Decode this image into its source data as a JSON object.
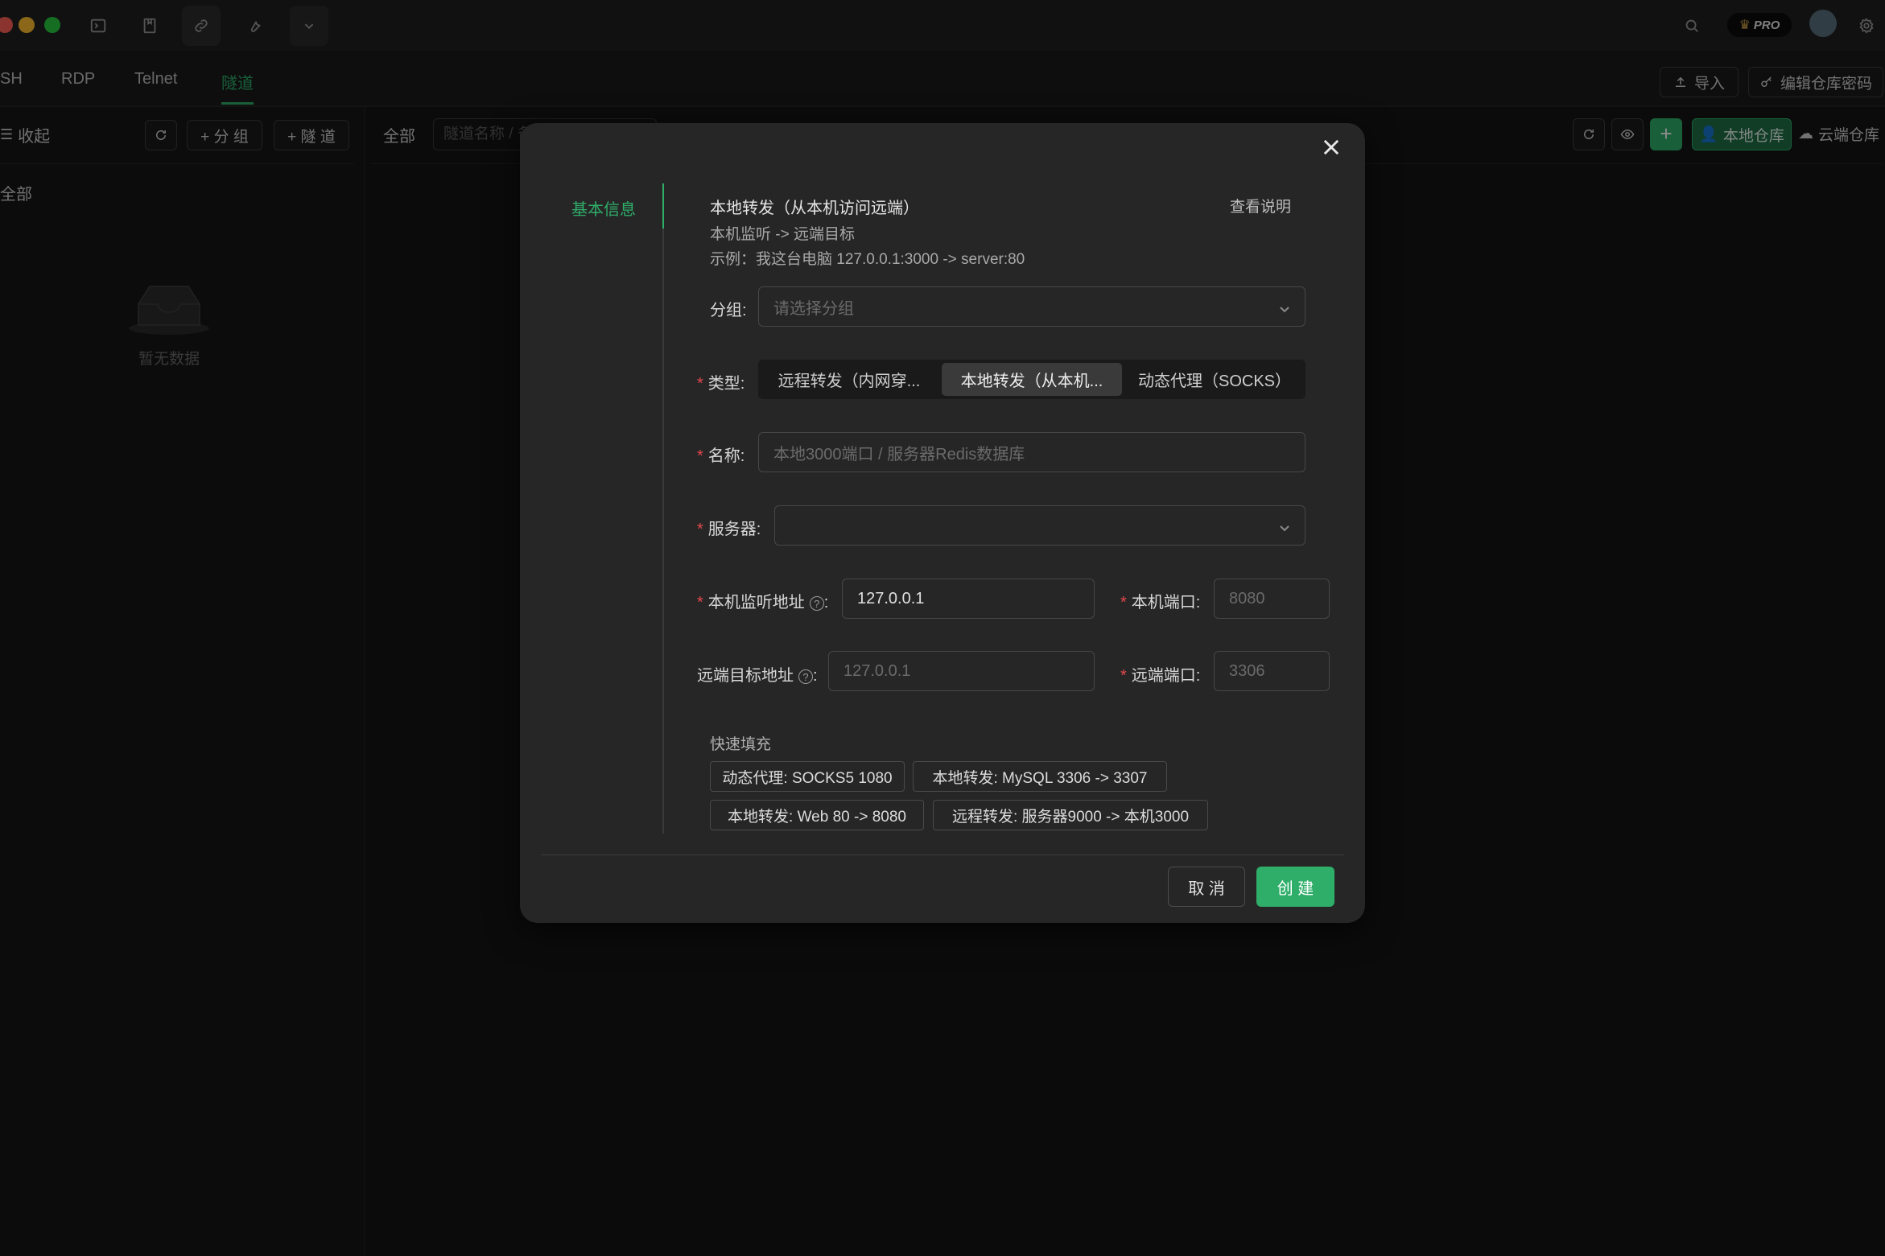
{
  "titlebar": {
    "pro_badge": "PRO"
  },
  "protocol_tabs": [
    "SH",
    "RDP",
    "Telnet",
    "隧道"
  ],
  "toolbar_right": {
    "import": "导入",
    "edit_password": "编辑仓库密码"
  },
  "sidebar": {
    "collapse": "收起",
    "add_group": "+ 分 组",
    "add_tunnel": "+ 隧 道",
    "all": "全部",
    "empty": "暂无数据"
  },
  "main": {
    "filter_all": "全部",
    "search_placeholder": "隧道名称 / 备注",
    "local_repo": "本地仓库",
    "cloud_repo": "云端仓库"
  },
  "modal": {
    "side_tab": "基本信息",
    "heading": "本地转发（从本机访问远端）",
    "desc_line1": "本机监听 -> 远端目标",
    "desc_line2": "示例：我这台电脑 127.0.0.1:3000 -> server:80",
    "help_link": "查看说明",
    "group_label": "分组:",
    "group_placeholder": "请选择分组",
    "type_label": "类型:",
    "type_options": [
      "远程转发（内网穿...",
      "本地转发（从本机...",
      "动态代理（SOCKS）"
    ],
    "type_selected": "本地转发（从本机...",
    "name_label": "名称:",
    "name_placeholder": "本地3000端口 / 服务器Redis数据库",
    "server_label": "服务器:",
    "local_addr_label": "本机监听地址",
    "local_addr_value": "127.0.0.1",
    "local_port_label": "本机端口:",
    "local_port_placeholder": "8080",
    "remote_addr_label": "远端目标地址",
    "remote_addr_placeholder": "127.0.0.1",
    "remote_port_label": "远端端口:",
    "remote_port_placeholder": "3306",
    "quick_fill_title": "快速填充",
    "quick_fill": [
      "动态代理: SOCKS5 1080",
      "本地转发: MySQL 3306 -> 3307",
      "本地转发: Web 80 -> 8080",
      "远程转发: 服务器9000 -> 本机3000"
    ],
    "cancel": "取 消",
    "create": "创 建"
  },
  "colors": {
    "accent": "#2fae6a",
    "danger": "#e5484d",
    "background": "#111111",
    "modal": "#262626"
  }
}
